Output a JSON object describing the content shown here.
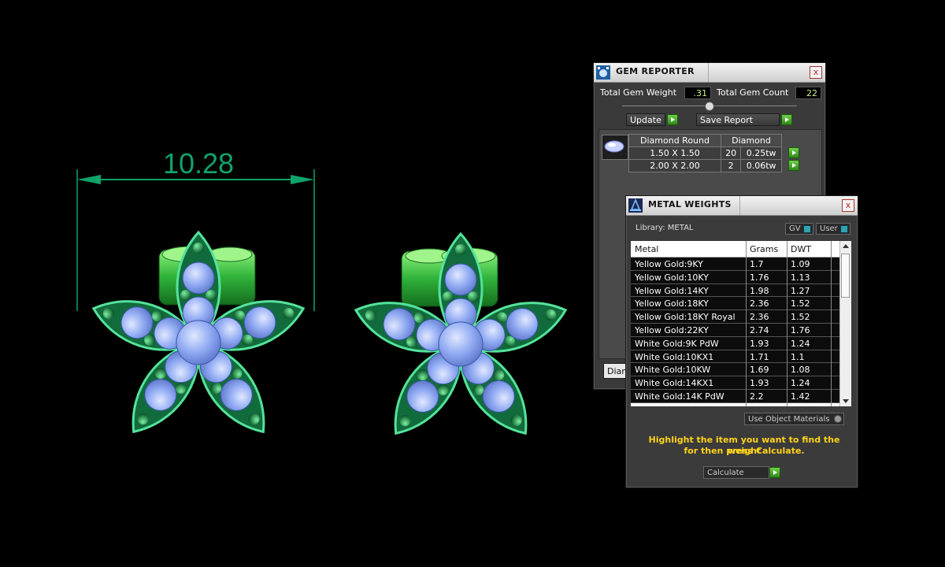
{
  "viewport": {
    "dimension_value": "10.28",
    "colors": {
      "dimension": "#0fa36a",
      "metal": "#1f9a3f",
      "gem": "#8fb0ff"
    }
  },
  "gem_reporter": {
    "title": "GEM REPORTER",
    "close": "x",
    "total_weight_label": "Total Gem Weight",
    "total_weight_value": ".31",
    "total_count_label": "Total Gem Count",
    "total_count_value": "22",
    "update_label": "Update",
    "save_report_label": "Save Report",
    "table_header": {
      "shape": "Diamond Round",
      "material": "Diamond"
    },
    "rows": [
      {
        "size": "1.50 X 1.50",
        "count": "20",
        "weight": "0.25tw"
      },
      {
        "size": "2.00 X 2.00",
        "count": "2",
        "weight": "0.06tw"
      }
    ],
    "bottom_tab": "Diam"
  },
  "metal_weights": {
    "title": "METAL WEIGHTS",
    "close": "x",
    "library_label": "Library: METAL",
    "gv_label": "GV",
    "user_label": "User",
    "columns": [
      "Metal",
      "Grams",
      "DWT"
    ],
    "rows": [
      {
        "metal": "Yellow Gold:9KY",
        "grams": "1.7",
        "dwt": "1.09"
      },
      {
        "metal": "Yellow Gold:10KY",
        "grams": "1.76",
        "dwt": "1.13"
      },
      {
        "metal": "Yellow Gold:14KY",
        "grams": "1.98",
        "dwt": "1.27"
      },
      {
        "metal": "Yellow Gold:18KY",
        "grams": "2.36",
        "dwt": "1.52"
      },
      {
        "metal": "Yellow Gold:18KY Royal",
        "grams": "2.36",
        "dwt": "1.52"
      },
      {
        "metal": "Yellow Gold:22KY",
        "grams": "2.74",
        "dwt": "1.76"
      },
      {
        "metal": "White Gold:9K PdW",
        "grams": "1.93",
        "dwt": "1.24"
      },
      {
        "metal": "White Gold:10KX1",
        "grams": "1.71",
        "dwt": "1.1"
      },
      {
        "metal": "White Gold:10KW",
        "grams": "1.69",
        "dwt": "1.08"
      },
      {
        "metal": "White Gold:14KX1",
        "grams": "1.93",
        "dwt": "1.24"
      },
      {
        "metal": "White Gold:14K PdW",
        "grams": "2.2",
        "dwt": "1.42"
      }
    ],
    "use_object_materials": "Use Object Materials",
    "hint_line1": "Highlight the item you want to find the weight",
    "hint_line2": "for then press Calculate.",
    "calculate_label": "Calculate"
  }
}
